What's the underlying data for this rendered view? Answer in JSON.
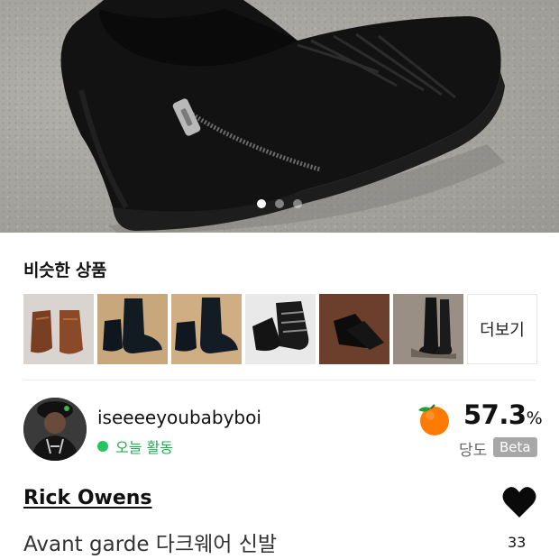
{
  "hero": {
    "image_alt": "black leather high-top zip sneaker",
    "carousel": {
      "count": 3,
      "active_index": 0
    }
  },
  "similar": {
    "title": "비슷한 상품",
    "thumbnails": [
      {
        "name": "brown-leather-boots"
      },
      {
        "name": "black-chelsea-boots"
      },
      {
        "name": "black-chelsea-boots-2"
      },
      {
        "name": "black-buckle-sneakers"
      },
      {
        "name": "black-laced-boots"
      },
      {
        "name": "black-tall-boots"
      }
    ],
    "more_label": "더보기"
  },
  "seller": {
    "username": "iseeeeyoubabyboi",
    "activity": "오늘 활동",
    "score_value": "57.3",
    "score_unit": "%",
    "score_label": "당도",
    "beta_label": "Beta"
  },
  "product": {
    "brand": "Rick Owens",
    "name": "Avant garde 다크웨어 신발",
    "likes": "33"
  },
  "colors": {
    "accent_green": "#22c55e",
    "orange": "#ff7a00",
    "beta_gray": "#a7a7a7"
  }
}
